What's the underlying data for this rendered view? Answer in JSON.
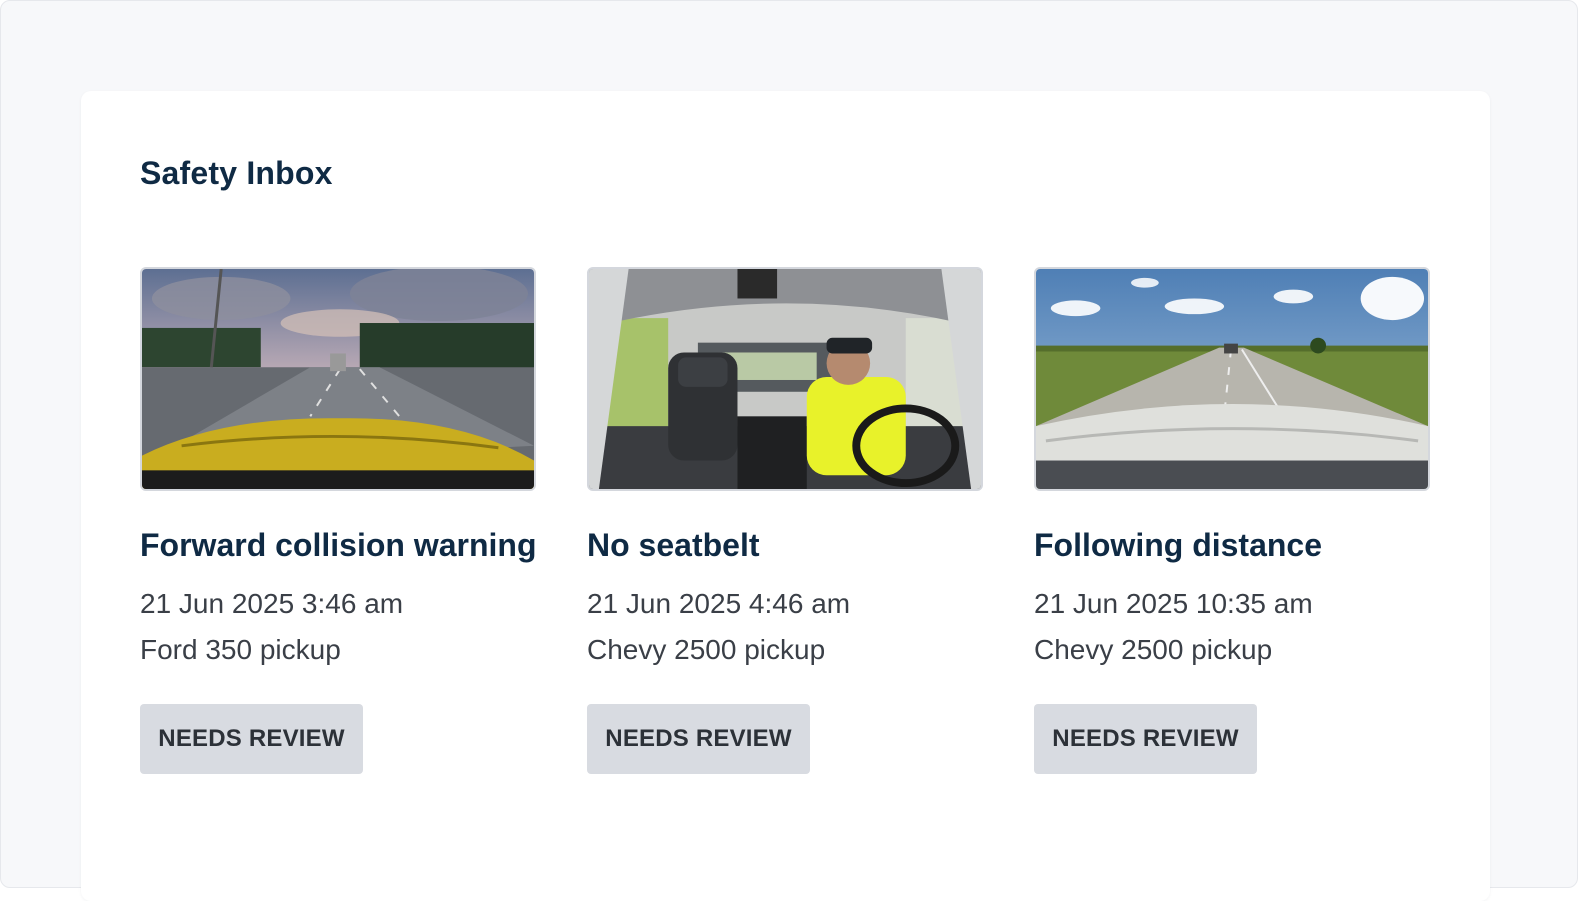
{
  "page": {
    "title": "Safety Inbox"
  },
  "events": [
    {
      "title": "Forward collision warning",
      "time": "21 Jun 2025 3:46 am",
      "vehicle": "Ford 350 pickup",
      "status": "NEEDS REVIEW",
      "thumbnail": "dashcam-highway-dusk"
    },
    {
      "title": "No seatbelt",
      "time": "21 Jun 2025 4:46 am",
      "vehicle": "Chevy 2500 pickup",
      "status": "NEEDS REVIEW",
      "thumbnail": "dashcam-cabin-driver"
    },
    {
      "title": "Following distance",
      "time": "21 Jun 2025 10:35 am",
      "vehicle": "Chevy 2500 pickup",
      "status": "NEEDS REVIEW",
      "thumbnail": "dashcam-rural-road"
    }
  ],
  "colors": {
    "heading": "#0f2a44",
    "body_text": "#3a3f47",
    "badge_bg": "#d8dbe1",
    "page_bg": "#f7f8fa"
  }
}
